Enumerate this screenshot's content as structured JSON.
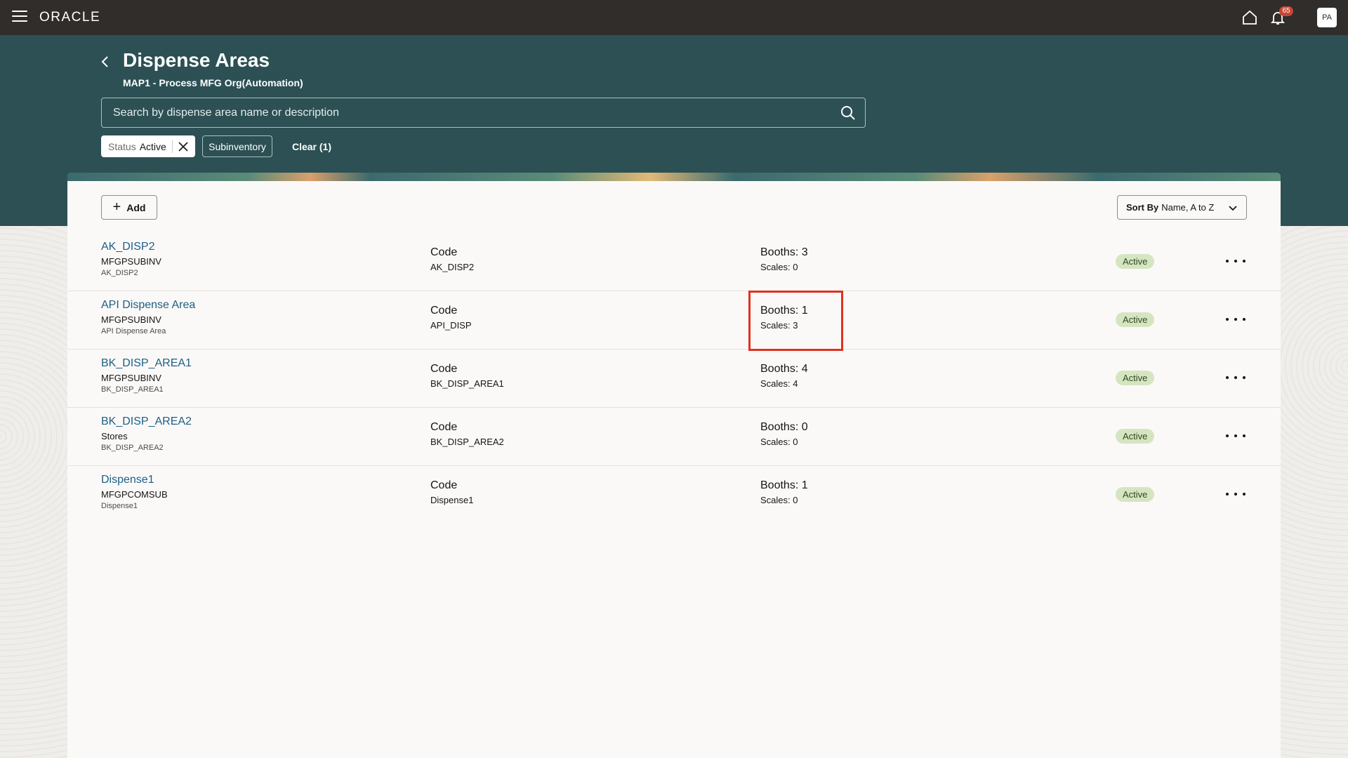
{
  "topbar": {
    "logo": "ORACLE",
    "notification_count": "65",
    "avatar_initials": "PA"
  },
  "header": {
    "title": "Dispense Areas",
    "subtitle": "MAP1 - Process MFG Org(Automation)",
    "search_placeholder": "Search by dispense area name or description"
  },
  "filters": {
    "status_label": "Status",
    "status_value": "Active",
    "subinventory": "Subinventory",
    "clear": "Clear (1)"
  },
  "toolbar": {
    "add_label": "Add",
    "sort_prefix": "Sort By",
    "sort_value": "Name, A to Z"
  },
  "rows": [
    {
      "name": "AK_DISP2",
      "subinventory": "MFGPSUBINV",
      "description": "AK_DISP2",
      "code_label": "Code",
      "code": "AK_DISP2",
      "booths": "Booths: 3",
      "scales": "Scales: 0",
      "status": "Active"
    },
    {
      "name": "API Dispense Area",
      "subinventory": "MFGPSUBINV",
      "description": "API Dispense Area",
      "code_label": "Code",
      "code": "API_DISP",
      "booths": "Booths: 1",
      "scales": "Scales: 3",
      "status": "Active"
    },
    {
      "name": "BK_DISP_AREA1",
      "subinventory": "MFGPSUBINV",
      "description": "BK_DISP_AREA1",
      "code_label": "Code",
      "code": "BK_DISP_AREA1",
      "booths": "Booths: 4",
      "scales": "Scales: 4",
      "status": "Active"
    },
    {
      "name": "BK_DISP_AREA2",
      "subinventory": "Stores",
      "description": "BK_DISP_AREA2",
      "code_label": "Code",
      "code": "BK_DISP_AREA2",
      "booths": "Booths: 0",
      "scales": "Scales: 0",
      "status": "Active"
    },
    {
      "name": "Dispense1",
      "subinventory": "MFGPCOMSUB",
      "description": "Dispense1",
      "code_label": "Code",
      "code": "Dispense1",
      "booths": "Booths: 1",
      "scales": "Scales: 0",
      "status": "Active"
    }
  ],
  "colors": {
    "topbar": "#312d2a",
    "header_band": "#2c5054",
    "link": "#1c5f86",
    "status_bg": "#d5e5c2",
    "highlight": "#e0311f"
  }
}
